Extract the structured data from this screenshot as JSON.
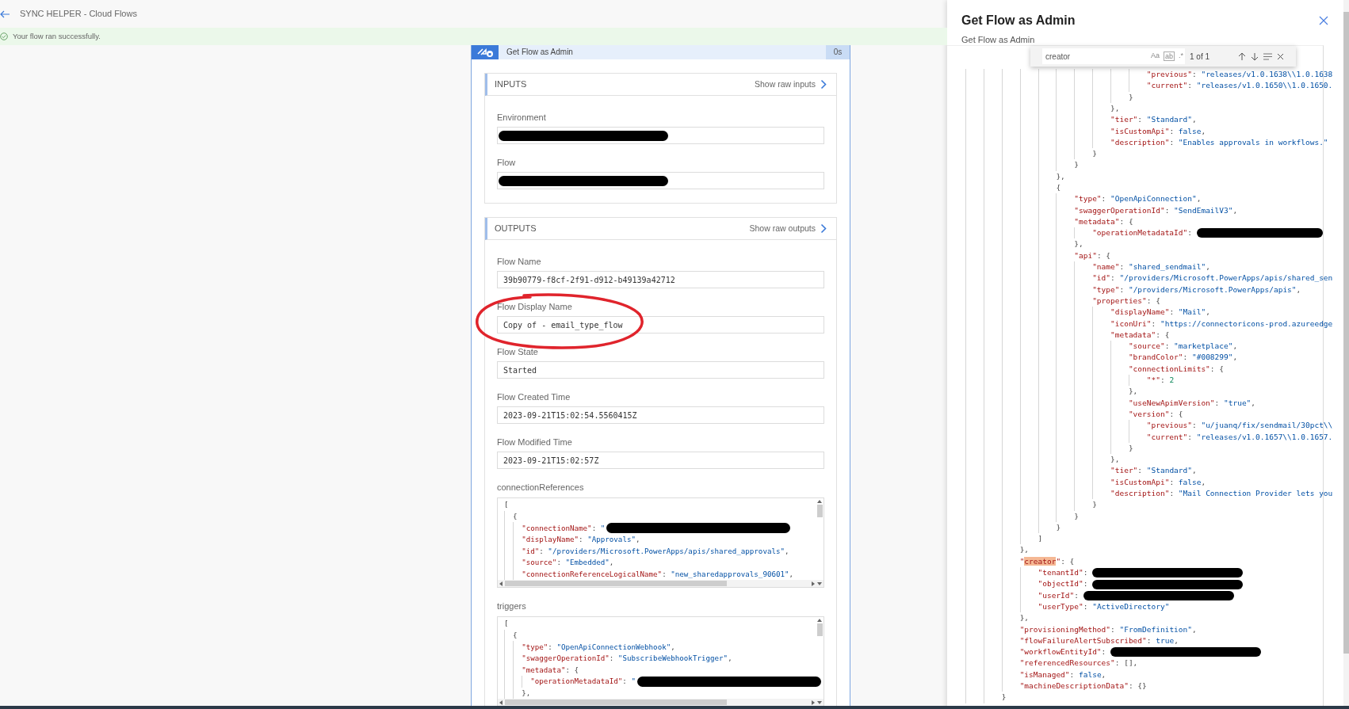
{
  "header": {
    "title": "SYNC HELPER - Cloud Flows"
  },
  "banner": {
    "message": "Your flow ran successfully."
  },
  "action_card": {
    "title": "Get Flow as Admin",
    "duration": "0s",
    "sections": [
      {
        "title": "INPUTS",
        "raw_link": "Show raw inputs",
        "fields": [
          {
            "kind": "text",
            "label": "Environment",
            "redacted": true,
            "annotated": false
          },
          {
            "kind": "text",
            "label": "Flow",
            "redacted": true,
            "annotated": false
          }
        ]
      },
      {
        "title": "OUTPUTS",
        "raw_link": "Show raw outputs",
        "fields": [
          {
            "kind": "text",
            "label": "Flow Name",
            "value": "39b90779-f8cf-2f91-d912-b49139a42712",
            "redacted": false,
            "annotated": false
          },
          {
            "kind": "text",
            "label": "Flow Display Name",
            "value": "Copy of - email_type_flow",
            "redacted": false,
            "annotated": true
          },
          {
            "kind": "text",
            "label": "Flow State",
            "value": "Started",
            "redacted": false,
            "annotated": false
          },
          {
            "kind": "text",
            "label": "Flow Created Time",
            "value": "2023-09-21T15:02:54.5560415Z",
            "redacted": false,
            "annotated": false
          },
          {
            "kind": "text",
            "label": "Flow Modified Time",
            "value": "2023-09-21T15:02:57Z",
            "redacted": false,
            "annotated": false
          },
          {
            "kind": "code",
            "label": "connectionReferences",
            "lines": [
              {
                "text": "[",
                "redacted": false
              },
              {
                "text": "  {",
                "redacted": false
              },
              {
                "text": "    \"connectionName\": \"",
                "redacted": true
              },
              {
                "text": "    \"displayName\": \"Approvals\",",
                "redacted": false
              },
              {
                "text": "    \"id\": \"/providers/Microsoft.PowerApps/apis/shared_approvals\",",
                "redacted": false
              },
              {
                "text": "    \"source\": \"Embedded\",",
                "redacted": false
              },
              {
                "text": "    \"connectionReferenceLogicalName\": \"new_sharedapprovals_90601\",",
                "redacted": false
              }
            ]
          },
          {
            "kind": "code",
            "label": "triggers",
            "lines": [
              {
                "text": "[",
                "redacted": false
              },
              {
                "text": "  {",
                "redacted": false
              },
              {
                "text": "    \"type\": \"OpenApiConnectionWebhook\",",
                "redacted": false
              },
              {
                "text": "    \"swaggerOperationId\": \"SubscribeWebhookTrigger\",",
                "redacted": false
              },
              {
                "text": "    \"metadata\": {",
                "redacted": false
              },
              {
                "text": "      \"operationMetadataId\": \"",
                "redacted": true
              },
              {
                "text": "    },",
                "redacted": false
              }
            ]
          }
        ]
      }
    ]
  },
  "panel": {
    "title": "Get Flow as Admin",
    "subtitle": "Get Flow as Admin",
    "find": {
      "value": "creator",
      "options": [
        "Aa",
        "ab",
        ".*"
      ],
      "count": "1 of 1"
    },
    "lines": [
      {
        "text": "                                        \"previous\": \"releases/v1.0.1638\\\\1.0.1638",
        "redacted": false,
        "match": false
      },
      {
        "text": "                                        \"current\": \"releases/v1.0.1650\\\\1.0.1650.",
        "redacted": false,
        "match": false
      },
      {
        "text": "                                    }",
        "redacted": false,
        "match": false
      },
      {
        "text": "                                },",
        "redacted": false,
        "match": false
      },
      {
        "text": "                                \"tier\": \"Standard\",",
        "redacted": false,
        "match": false
      },
      {
        "text": "                                \"isCustomApi\": false,",
        "redacted": false,
        "match": false
      },
      {
        "text": "                                \"description\": \"Enables approvals in workflows.\"",
        "redacted": false,
        "match": false
      },
      {
        "text": "                            }",
        "redacted": false,
        "match": false
      },
      {
        "text": "                        }",
        "redacted": false,
        "match": false
      },
      {
        "text": "                    },",
        "redacted": false,
        "match": false
      },
      {
        "text": "                    {",
        "redacted": false,
        "match": false
      },
      {
        "text": "                        \"type\": \"OpenApiConnection\",",
        "redacted": false,
        "match": false
      },
      {
        "text": "                        \"swaggerOperationId\": \"SendEmailV3\",",
        "redacted": false,
        "match": false
      },
      {
        "text": "                        \"metadata\": {",
        "redacted": false,
        "match": false
      },
      {
        "text": "                            \"operationMetadataId\": ",
        "redacted": true,
        "match": false
      },
      {
        "text": "                        },",
        "redacted": false,
        "match": false
      },
      {
        "text": "                        \"api\": {",
        "redacted": false,
        "match": false
      },
      {
        "text": "                            \"name\": \"shared_sendmail\",",
        "redacted": false,
        "match": false
      },
      {
        "text": "                            \"id\": \"/providers/Microsoft.PowerApps/apis/shared_sen",
        "redacted": false,
        "match": false
      },
      {
        "text": "                            \"type\": \"/providers/Microsoft.PowerApps/apis\",",
        "redacted": false,
        "match": false
      },
      {
        "text": "                            \"properties\": {",
        "redacted": false,
        "match": false
      },
      {
        "text": "                                \"displayName\": \"Mail\",",
        "redacted": false,
        "match": false
      },
      {
        "text": "                                \"iconUri\": \"https://connectoricons-prod.azureedge",
        "redacted": false,
        "match": false
      },
      {
        "text": "                                \"metadata\": {",
        "redacted": false,
        "match": false
      },
      {
        "text": "                                    \"source\": \"marketplace\",",
        "redacted": false,
        "match": false
      },
      {
        "text": "                                    \"brandColor\": \"#008299\",",
        "redacted": false,
        "match": false
      },
      {
        "text": "                                    \"connectionLimits\": {",
        "redacted": false,
        "match": false
      },
      {
        "text": "                                        \"*\": 2",
        "redacted": false,
        "match": false
      },
      {
        "text": "                                    },",
        "redacted": false,
        "match": false
      },
      {
        "text": "                                    \"useNewApimVersion\": \"true\",",
        "redacted": false,
        "match": false
      },
      {
        "text": "                                    \"version\": {",
        "redacted": false,
        "match": false
      },
      {
        "text": "                                        \"previous\": \"u/juanq/fix/sendmail/30pct\\\\",
        "redacted": false,
        "match": false
      },
      {
        "text": "                                        \"current\": \"releases/v1.0.1657\\\\1.0.1657.",
        "redacted": false,
        "match": false
      },
      {
        "text": "                                    }",
        "redacted": false,
        "match": false
      },
      {
        "text": "                                },",
        "redacted": false,
        "match": false
      },
      {
        "text": "                                \"tier\": \"Standard\",",
        "redacted": false,
        "match": false
      },
      {
        "text": "                                \"isCustomApi\": false,",
        "redacted": false,
        "match": false
      },
      {
        "text": "                                \"description\": \"Mail Connection Provider lets you",
        "redacted": false,
        "match": false
      },
      {
        "text": "                            }",
        "redacted": false,
        "match": false
      },
      {
        "text": "                        }",
        "redacted": false,
        "match": false
      },
      {
        "text": "                    }",
        "redacted": false,
        "match": false
      },
      {
        "text": "                ]",
        "redacted": false,
        "match": false
      },
      {
        "text": "            },",
        "redacted": false,
        "match": false
      },
      {
        "text": "            \"creator\": {",
        "redacted": false,
        "match": true
      },
      {
        "text": "                \"tenantId\": ",
        "redacted": true,
        "match": false
      },
      {
        "text": "                \"objectId\": ",
        "redacted": true,
        "match": false
      },
      {
        "text": "                \"userId\": ",
        "redacted": true,
        "match": false
      },
      {
        "text": "                \"userType\": \"ActiveDirectory\"",
        "redacted": false,
        "match": false
      },
      {
        "text": "            },",
        "redacted": false,
        "match": false
      },
      {
        "text": "            \"provisioningMethod\": \"FromDefinition\",",
        "redacted": false,
        "match": false
      },
      {
        "text": "            \"flowFailureAlertSubscribed\": true,",
        "redacted": false,
        "match": false
      },
      {
        "text": "            \"workflowEntityId\": ",
        "redacted": true,
        "match": false
      },
      {
        "text": "            \"referencedResources\": [],",
        "redacted": false,
        "match": false
      },
      {
        "text": "            \"isManaged\": false,",
        "redacted": false,
        "match": false
      },
      {
        "text": "            \"machineDescriptionData\": {}",
        "redacted": false,
        "match": false
      },
      {
        "text": "        }",
        "redacted": false,
        "match": false
      }
    ]
  }
}
